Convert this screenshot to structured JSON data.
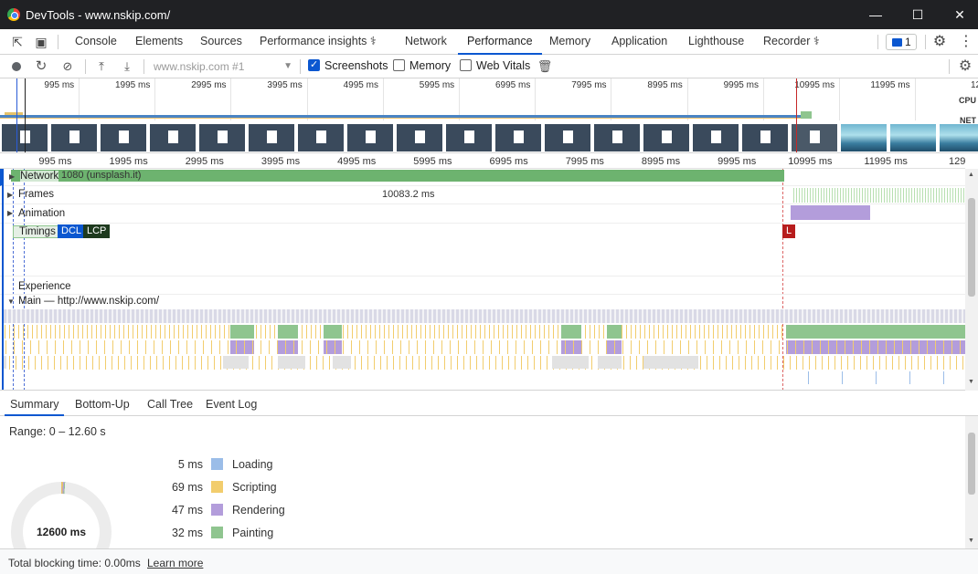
{
  "window": {
    "title": "DevTools - www.nskip.com/"
  },
  "tabs": [
    {
      "label": "Console"
    },
    {
      "label": "Elements"
    },
    {
      "label": "Sources"
    },
    {
      "label": "Performance insights"
    },
    {
      "label": "Network"
    },
    {
      "label": "Performance"
    },
    {
      "label": "Memory"
    },
    {
      "label": "Application"
    },
    {
      "label": "Lighthouse"
    },
    {
      "label": "Recorder"
    }
  ],
  "active_tab": "Performance",
  "issues_count": "1",
  "toolbar": {
    "profile_select": "www.nskip.com #1",
    "screenshots_label": "Screenshots",
    "screenshots_checked": true,
    "memory_label": "Memory",
    "memory_checked": false,
    "webvitals_label": "Web Vitals",
    "webvitals_checked": false
  },
  "overview": {
    "ticks": [
      "995 ms",
      "1995 ms",
      "2995 ms",
      "3995 ms",
      "4995 ms",
      "5995 ms",
      "6995 ms",
      "7995 ms",
      "8995 ms",
      "9995 ms",
      "10995 ms",
      "11995 ms",
      "12"
    ],
    "cpu_label": "CPU",
    "net_label": "NET"
  },
  "timeline": {
    "ticks": [
      "995 ms",
      "1995 ms",
      "2995 ms",
      "3995 ms",
      "4995 ms",
      "5995 ms",
      "6995 ms",
      "7995 ms",
      "8995 ms",
      "9995 ms",
      "10995 ms",
      "11995 ms",
      "129"
    ],
    "network_label": "Network",
    "network_bar_text": "1080 (unsplash.it)",
    "frames_label": "Frames",
    "frames_text": "10083.2 ms",
    "animation_label": "Animation",
    "timings_label": "Timings",
    "dcl_label": "DCL",
    "lcp_label": "LCP",
    "load_label": "L",
    "experience_label": "Experience",
    "main_label": "Main — http://www.nskip.com/"
  },
  "bottom_tabs": [
    {
      "label": "Summary"
    },
    {
      "label": "Bottom-Up"
    },
    {
      "label": "Call Tree"
    },
    {
      "label": "Event Log"
    }
  ],
  "summary": {
    "range": "Range: 0 – 12.60 s",
    "total": "12600 ms",
    "items": [
      {
        "value": "5 ms",
        "name": "Loading",
        "color": "#9bbde8"
      },
      {
        "value": "69 ms",
        "name": "Scripting",
        "color": "#f2cd6d"
      },
      {
        "value": "47 ms",
        "name": "Rendering",
        "color": "#b39ddb"
      },
      {
        "value": "32 ms",
        "name": "Painting",
        "color": "#8fc58f"
      }
    ]
  },
  "status": {
    "total_blocking": "Total blocking time: 0.00ms",
    "learn_more": "Learn more"
  },
  "colors": {
    "accent": "#0b57d0",
    "dcl": "#0b57d0",
    "lcp": "#1e3a1e",
    "load": "#b71c1c"
  }
}
